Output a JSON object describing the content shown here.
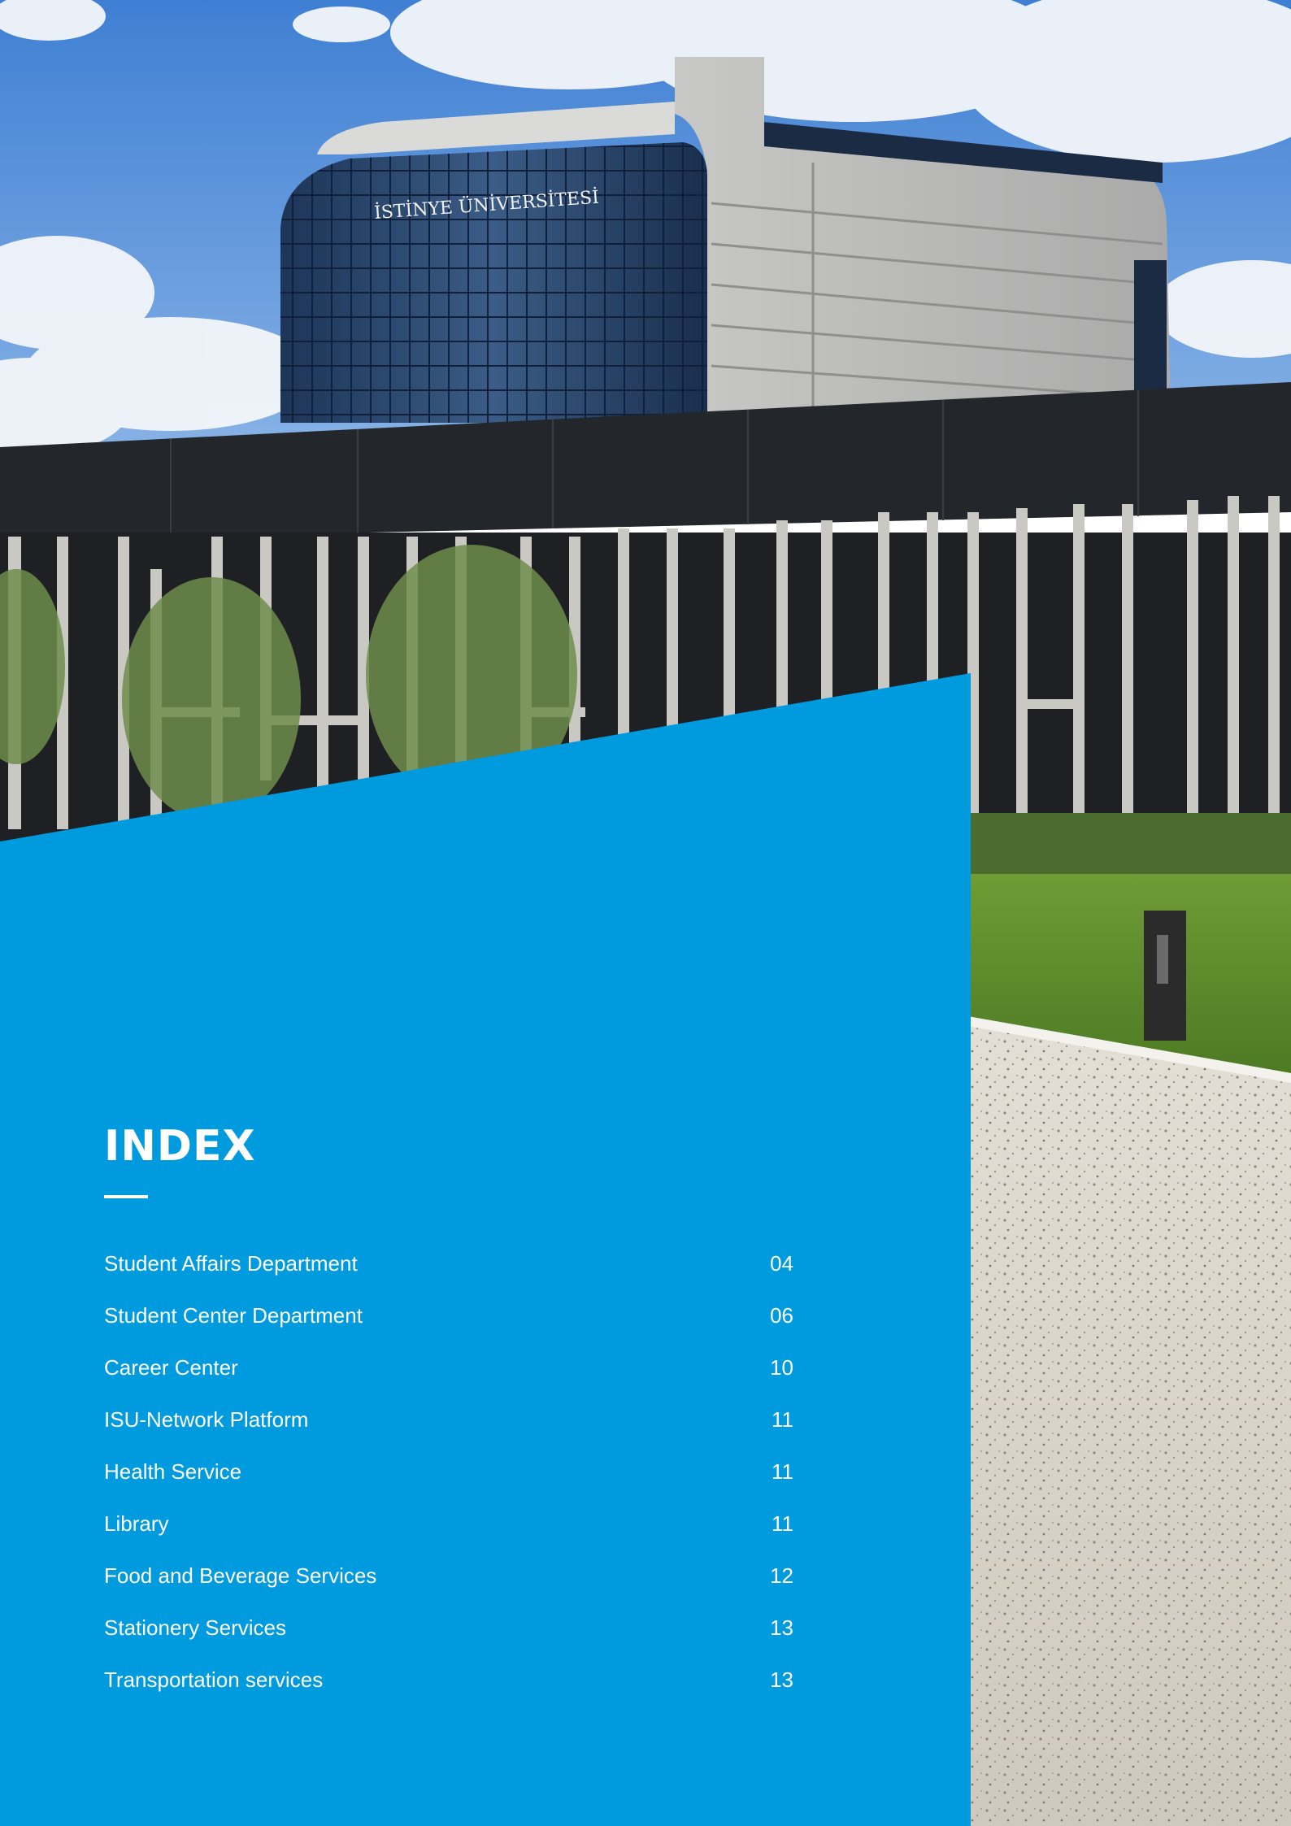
{
  "sign_text": "İSTİNYE ÜNİVERSİTESİ",
  "index": {
    "title": "INDEX",
    "entries": [
      {
        "label": "Student Affairs Department",
        "page": "04"
      },
      {
        "label": "Student Center Department",
        "page": "06"
      },
      {
        "label": "Career Center",
        "page": "10"
      },
      {
        "label": "ISU-Network Platform",
        "page": "11"
      },
      {
        "label": "Health Service",
        "page": "11"
      },
      {
        "label": "Library",
        "page": "11"
      },
      {
        "label": "Food and Beverage Services",
        "page": "12"
      },
      {
        "label": "Stationery Services",
        "page": "13"
      },
      {
        "label": "Transportation services",
        "page": "13"
      }
    ]
  },
  "colors": {
    "panel_blue": "#009ADE",
    "sky": "#3F7FD3",
    "wall_dark": "#23262A",
    "stripe": "#C9C8C3",
    "lawn": "#5F8C2E",
    "pavement": "#DCD7CC"
  }
}
